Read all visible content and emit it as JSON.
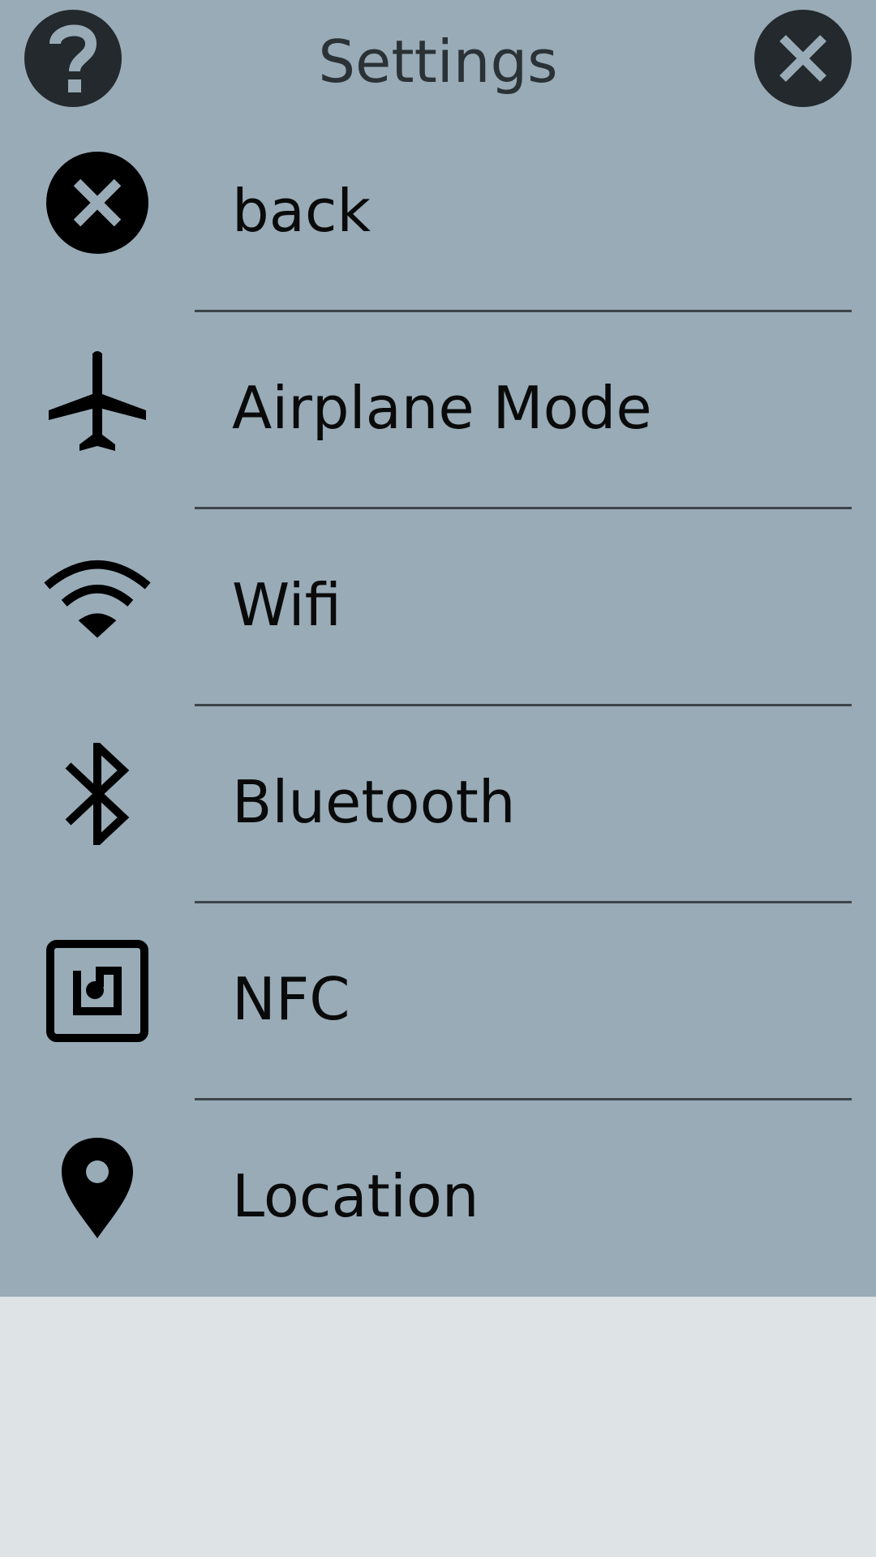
{
  "header": {
    "title": "Settings",
    "help_icon": "question-mark-icon",
    "close_icon": "close-x-icon"
  },
  "items": [
    {
      "label": "back",
      "icon": "back-close-circle-icon"
    },
    {
      "label": "Airplane Mode",
      "icon": "airplane-icon"
    },
    {
      "label": "Wifi",
      "icon": "wifi-icon"
    },
    {
      "label": "Bluetooth",
      "icon": "bluetooth-icon"
    },
    {
      "label": "NFC",
      "icon": "nfc-icon"
    },
    {
      "label": "Location",
      "icon": "location-pin-icon"
    }
  ],
  "colors": {
    "panel": "#98abb7",
    "page_background": "#dee3e5",
    "header_button": "#23292c",
    "divider": "#3d4549",
    "text": "#0a0a0a"
  }
}
